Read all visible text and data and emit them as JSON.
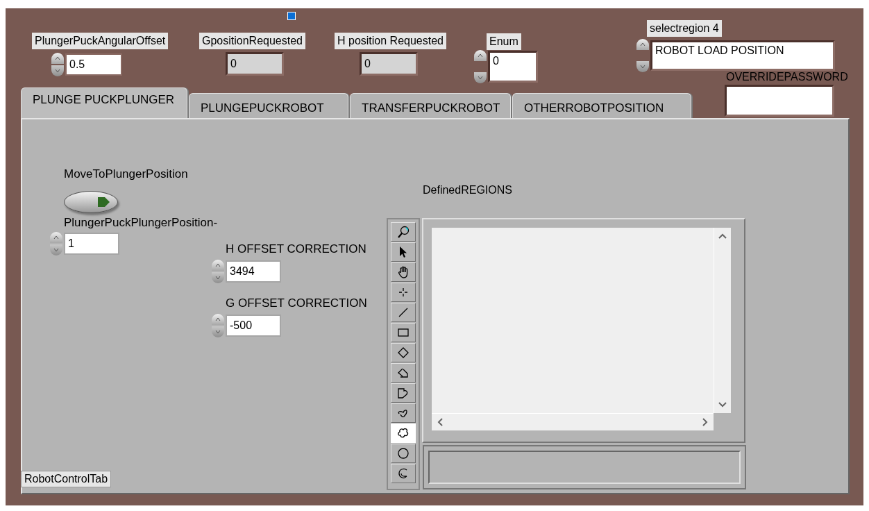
{
  "top_controls": [
    {
      "kind": "numeric",
      "label": "PlungerPuckAngularOffset",
      "value": "0.5"
    },
    {
      "kind": "indicator",
      "label": "GpositionRequested",
      "value": "0"
    },
    {
      "kind": "indicator",
      "label": "H position Requested",
      "value": "0"
    },
    {
      "kind": "enum",
      "label": "Enum",
      "value": "0"
    },
    {
      "kind": "ring",
      "label": "selectregion 4",
      "value": "ROBOT LOAD POSITION"
    },
    {
      "kind": "password",
      "label": "OVERRIDEPASSWORD"
    }
  ],
  "tab_control": {
    "label": "RobotControlTab",
    "tabs": [
      {
        "label": "PLUNGE PUCKPLUNGER",
        "selected": true
      },
      {
        "label": "PLUNGEPUCKROBOT",
        "selected": false
      },
      {
        "label": "TRANSFERPUCKROBOT",
        "selected": false
      },
      {
        "label": "OTHERROBOTPOSITION",
        "selected": false
      }
    ],
    "button": {
      "label": "MoveToPlungerPosition",
      "on": false
    },
    "numerics": [
      {
        "label": "PlungerPuckPlungerPosition-",
        "value": "1"
      },
      {
        "label": "H OFFSET CORRECTION",
        "value": "3494"
      },
      {
        "label": "G OFFSET CORRECTION",
        "value": "-500"
      }
    ],
    "image_display": {
      "label": "DefinedREGIONS",
      "tools": [
        {
          "kind": "zoom",
          "selected": false
        },
        {
          "kind": "pointer",
          "selected": false
        },
        {
          "kind": "pan",
          "selected": false
        },
        {
          "kind": "point",
          "selected": false
        },
        {
          "kind": "line",
          "selected": false
        },
        {
          "kind": "rectangle",
          "selected": false
        },
        {
          "kind": "rotated-rectangle",
          "selected": false
        },
        {
          "kind": "polyline",
          "selected": false
        },
        {
          "kind": "polygon",
          "selected": false
        },
        {
          "kind": "freehand-line",
          "selected": false
        },
        {
          "kind": "freehand-region",
          "selected": true
        },
        {
          "kind": "oval",
          "selected": false
        },
        {
          "kind": "annulus",
          "selected": false
        }
      ]
    }
  }
}
